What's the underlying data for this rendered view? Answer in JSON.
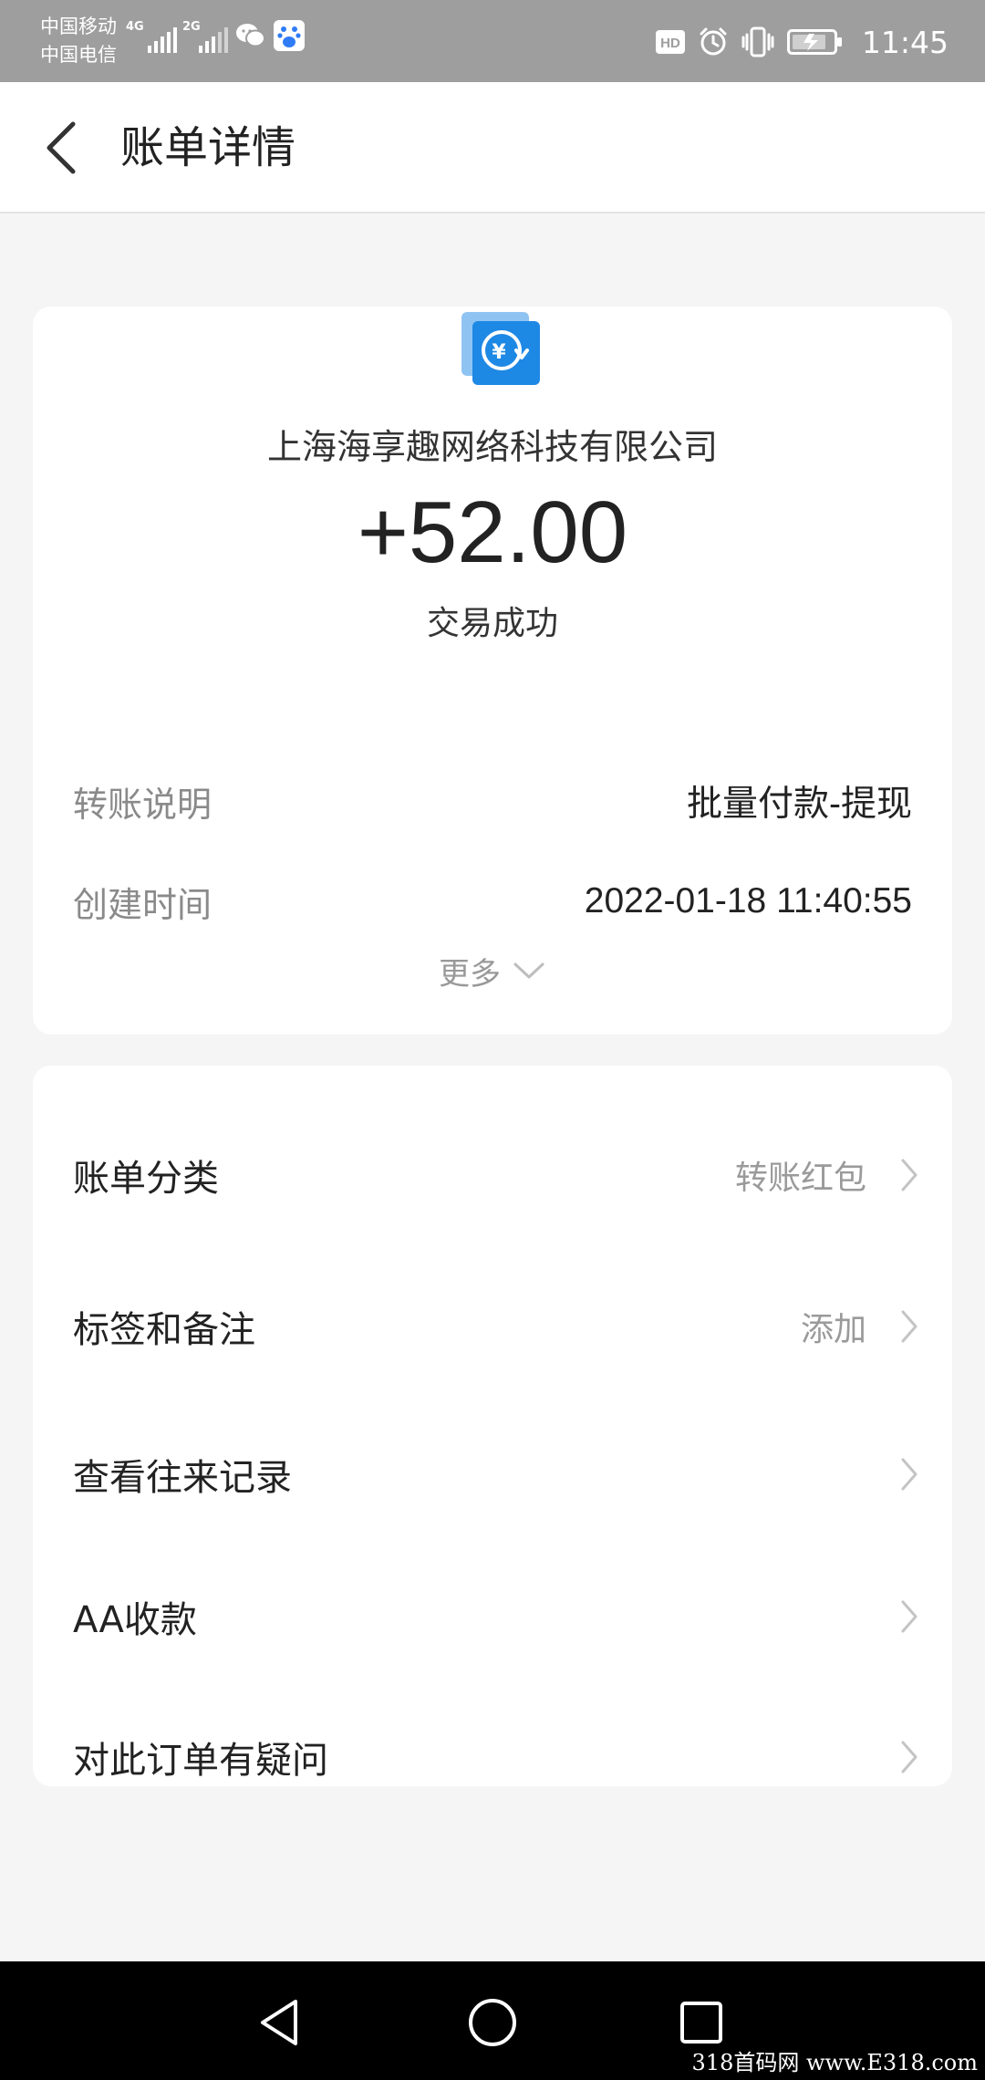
{
  "status_bar": {
    "carrier_1": "中国移动",
    "carrier_2": "中国电信",
    "network_1": "4G",
    "network_2": "2G",
    "hd_badge": "HD",
    "time": "11:45",
    "icons": [
      "wechat-icon",
      "baidu-icon",
      "alarm-icon",
      "vibrate-icon",
      "battery-icon"
    ]
  },
  "header": {
    "title": "账单详情"
  },
  "bill": {
    "payee": "上海海享趣网络科技有限公司",
    "amount": "+52.00",
    "status": "交易成功",
    "details": [
      {
        "label": "转账说明",
        "value": "批量付款-提现"
      },
      {
        "label": "创建时间",
        "value": "2022-01-18 11:40:55"
      }
    ],
    "more_label": "更多"
  },
  "actions": [
    {
      "label": "账单分类",
      "value": "转账红包"
    },
    {
      "label": "标签和备注",
      "value": "添加"
    },
    {
      "label": "查看往来记录",
      "value": ""
    },
    {
      "label": "AA收款",
      "value": ""
    },
    {
      "label": "对此订单有疑问",
      "value": ""
    }
  ],
  "watermark": "318首码网 www.E318.com",
  "colors": {
    "status_bar": "#9e9e9e",
    "icon_blue": "#1e88e5",
    "background": "#f5f5f5"
  }
}
